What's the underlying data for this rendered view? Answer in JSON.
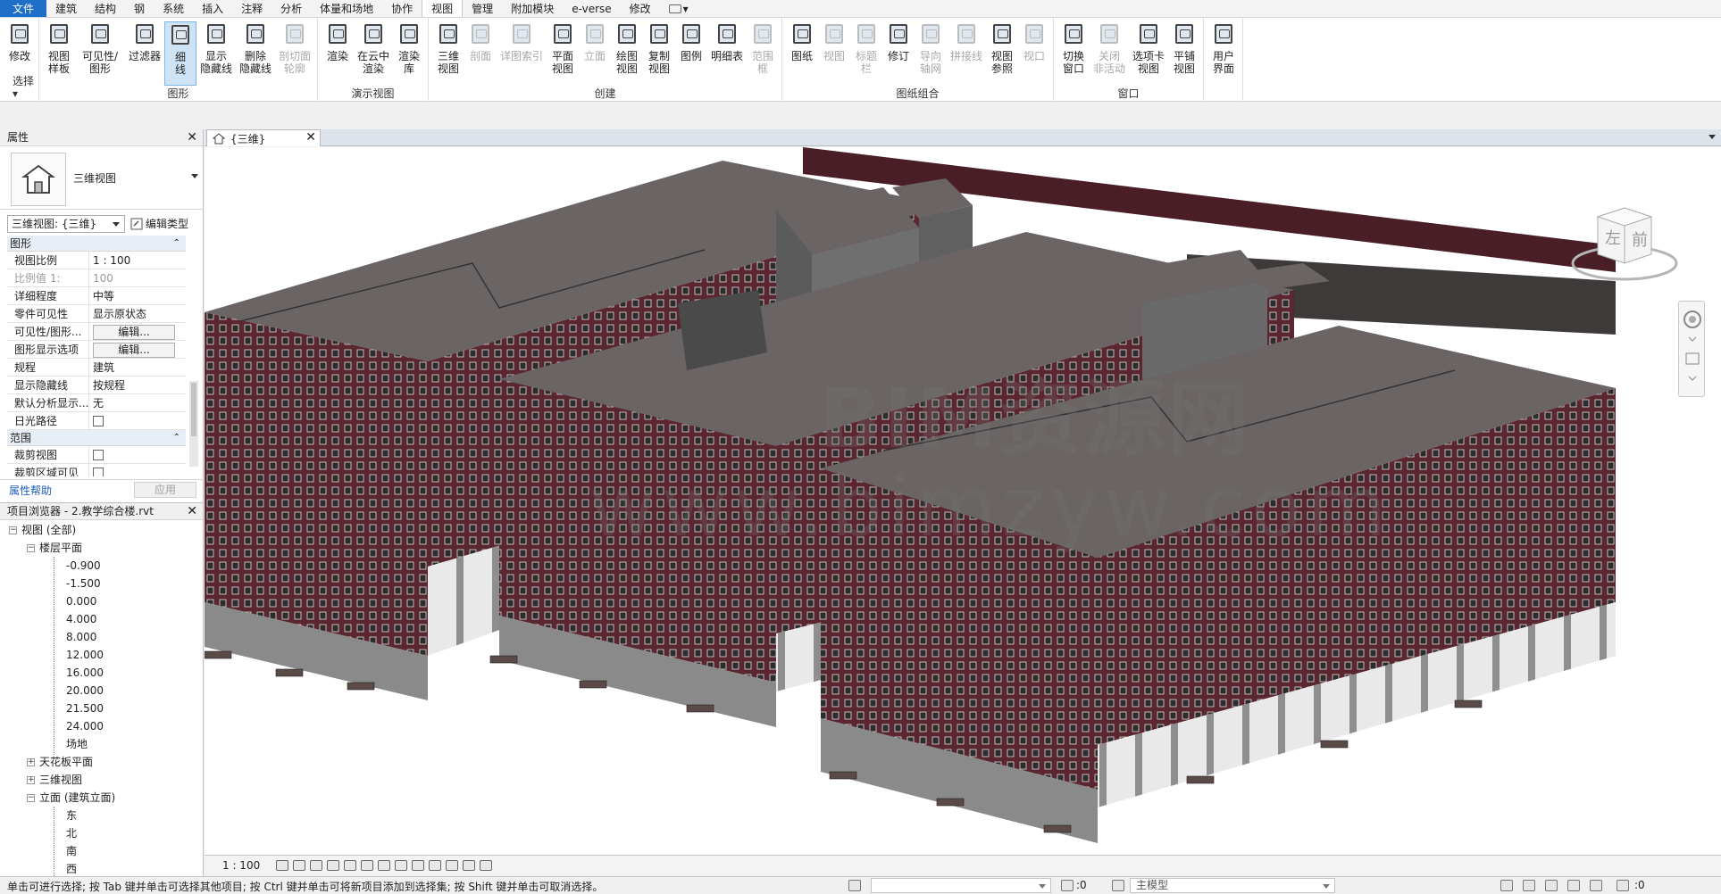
{
  "menu": {
    "tabs": [
      "文件",
      "建筑",
      "结构",
      "钢",
      "系统",
      "插入",
      "注释",
      "分析",
      "体量和场地",
      "协作",
      "视图",
      "管理",
      "附加模块",
      "e-verse",
      "修改"
    ],
    "active": "视图"
  },
  "ribbon": {
    "panels": [
      {
        "title": "选择 ▾",
        "buttons": [
          {
            "label": "修改",
            "icon": "cursor-icon"
          }
        ]
      },
      {
        "title": "图形",
        "buttons": [
          {
            "label": "视图\n样板",
            "icon": "view-template-icon"
          },
          {
            "label": "可见性/\n图形",
            "icon": "visibility-graphics-icon"
          },
          {
            "label": "过滤器",
            "icon": "filter-icon"
          },
          {
            "label": "细\n线",
            "icon": "thin-lines-icon"
          },
          {
            "label": "显示\n隐藏线",
            "icon": "show-hidden-lines-icon"
          },
          {
            "label": "删除\n隐藏线",
            "icon": "remove-hidden-lines-icon"
          },
          {
            "label": "剖切面\n轮廓",
            "icon": "cut-profile-icon"
          }
        ]
      },
      {
        "title": "演示视图",
        "buttons": [
          {
            "label": "渲染",
            "icon": "render-icon"
          },
          {
            "label": "在云中\n渲染",
            "icon": "cloud-render-icon"
          },
          {
            "label": "渲染\n库",
            "icon": "render-gallery-icon"
          }
        ]
      },
      {
        "title": "创建",
        "buttons": [
          {
            "label": "三维\n视图",
            "icon": "3d-view-icon"
          },
          {
            "label": "剖面",
            "icon": "section-icon"
          },
          {
            "label": "详图索引",
            "icon": "callout-icon"
          },
          {
            "label": "平面\n视图",
            "icon": "plan-view-icon"
          },
          {
            "label": "立面",
            "icon": "elevation-icon"
          },
          {
            "label": "绘图\n视图",
            "icon": "drafting-view-icon"
          },
          {
            "label": "复制\n视图",
            "icon": "duplicate-view-icon"
          },
          {
            "label": "图例",
            "icon": "legend-icon"
          },
          {
            "label": "明细表",
            "icon": "schedule-icon"
          },
          {
            "label": "范围\n框",
            "icon": "scope-box-icon"
          }
        ]
      },
      {
        "title": "图纸组合",
        "buttons": [
          {
            "label": "图纸",
            "icon": "sheet-icon"
          },
          {
            "label": "视图",
            "icon": "place-view-icon"
          },
          {
            "label": "标题\n栏",
            "icon": "title-block-icon"
          },
          {
            "label": "修订",
            "icon": "revision-icon"
          },
          {
            "label": "导向\n轴网",
            "icon": "guide-grid-icon"
          },
          {
            "label": "拼接线",
            "icon": "matchline-icon"
          },
          {
            "label": "视图\n参照",
            "icon": "view-reference-icon"
          },
          {
            "label": "视口",
            "icon": "viewport-icon"
          }
        ]
      },
      {
        "title": "窗口",
        "buttons": [
          {
            "label": "切换\n窗口",
            "icon": "switch-windows-icon"
          },
          {
            "label": "关闭\n非活动",
            "icon": "close-inactive-icon"
          },
          {
            "label": "选项卡\n视图",
            "icon": "tab-views-icon"
          },
          {
            "label": "平铺\n视图",
            "icon": "tile-views-icon"
          }
        ]
      },
      {
        "title": "",
        "buttons": [
          {
            "label": "用户\n界面",
            "icon": "user-interface-icon"
          }
        ]
      }
    ]
  },
  "properties": {
    "title": "属性",
    "type_name": "三维视图",
    "instance_selector": "三维视图: {三维}",
    "edit_type": "编辑类型",
    "sections": [
      {
        "name": "图形",
        "rows": [
          {
            "name": "视图比例",
            "value": "1 : 100"
          },
          {
            "name": "比例值 1:",
            "value": "100",
            "gray": true
          },
          {
            "name": "详细程度",
            "value": "中等"
          },
          {
            "name": "零件可见性",
            "value": "显示原状态"
          },
          {
            "name": "可见性/图形...",
            "value": "编辑...",
            "button": true
          },
          {
            "name": "图形显示选项",
            "value": "编辑...",
            "button": true
          },
          {
            "name": "规程",
            "value": "建筑"
          },
          {
            "name": "显示隐藏线",
            "value": "按规程"
          },
          {
            "name": "默认分析显示...",
            "value": "无"
          },
          {
            "name": "日光路径",
            "value": "",
            "checkbox": true
          }
        ]
      },
      {
        "name": "范围",
        "rows": [
          {
            "name": "裁剪视图",
            "value": "",
            "checkbox": true
          },
          {
            "name": "裁剪区域可见",
            "value": "",
            "checkbox": true
          }
        ]
      }
    ],
    "help": "属性帮助",
    "apply": "应用"
  },
  "browser": {
    "title": "项目浏览器 - 2.教学综合楼.rvt",
    "root": "视图 (全部)",
    "floor_plans": "楼层平面",
    "levels": [
      "-0.900",
      "-1.500",
      "0.000",
      "4.000",
      "8.000",
      "12.000",
      "16.000",
      "20.000",
      "21.500",
      "24.000",
      "场地"
    ],
    "ceiling_plans": "天花板平面",
    "views_3d": "三维视图",
    "elevations": "立面 (建筑立面)",
    "elevation_items": [
      "东",
      "北",
      "南",
      "西"
    ]
  },
  "view": {
    "tab_title": "{三维}",
    "watermark_1": "BIM资源网",
    "watermark_2": "www.bimzyw.com",
    "cube_left": "左",
    "cube_front": "前"
  },
  "viewbar": {
    "scale": "1 : 100"
  },
  "status": {
    "message": "单击可进行选择; 按 Tab 键并单击可选择其他项目; 按 Ctrl 键并单击可将新项目添加到选择集; 按 Shift 键并单击可取消选择。",
    "z_value": ":0",
    "model": "主模型",
    "filter": ":0"
  },
  "colors": {
    "accent": "#1e6fc8",
    "brick": "#5a2630",
    "roof": "#6b6464",
    "base": "#9a9a9a"
  }
}
